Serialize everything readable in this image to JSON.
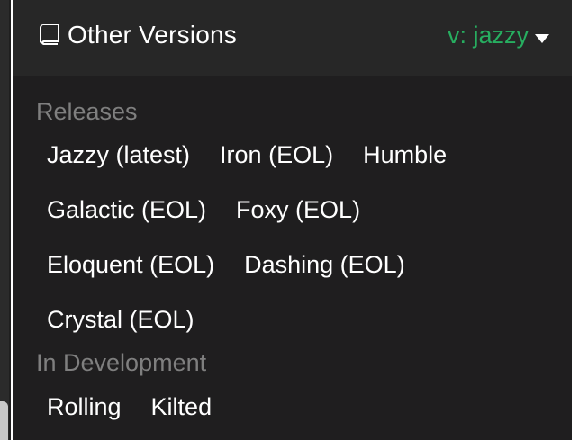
{
  "header": {
    "title": "Other Versions",
    "version_label": "v: jazzy",
    "icons": {
      "title_icon": "book-icon",
      "dropdown_icon": "caret-down-icon"
    },
    "colors": {
      "version_accent": "#27ae60"
    }
  },
  "sections": {
    "releases": {
      "label": "Releases",
      "rows": [
        [
          "Jazzy (latest)",
          "Iron (EOL)",
          "Humble"
        ],
        [
          "Galactic (EOL)",
          "Foxy (EOL)"
        ],
        [
          "Eloquent (EOL)",
          "Dashing (EOL)"
        ],
        [
          "Crystal (EOL)"
        ]
      ]
    },
    "in_development": {
      "label": "In Development",
      "rows": [
        [
          "Rolling",
          "Kilted"
        ]
      ]
    }
  }
}
